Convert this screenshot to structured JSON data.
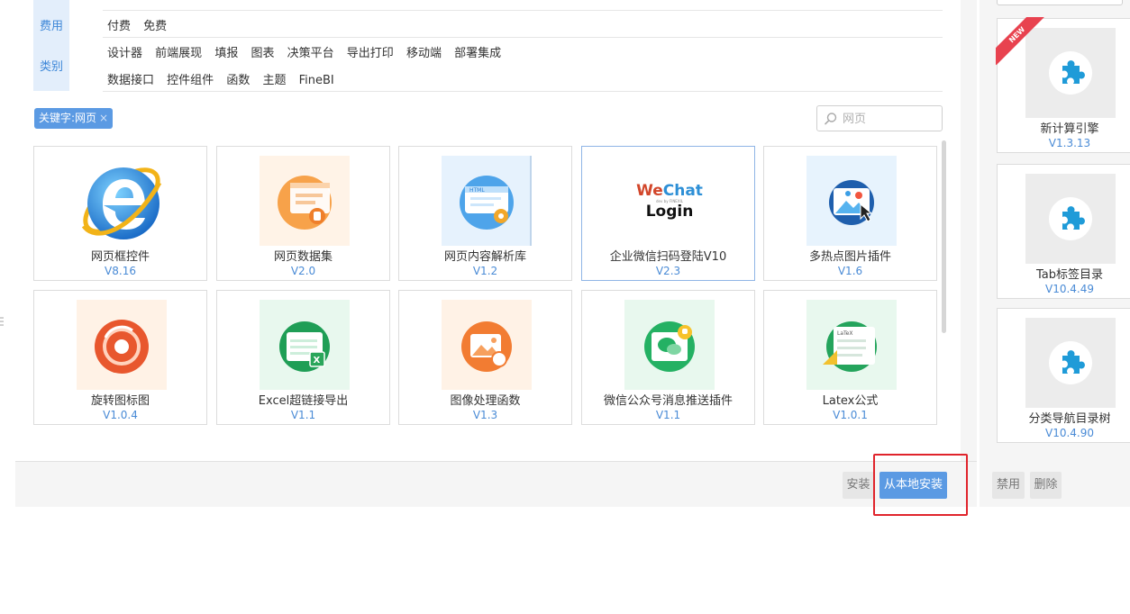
{
  "filters": {
    "row_top_partial": "",
    "fee": {
      "label": "费用",
      "options": [
        "付费",
        "免费"
      ]
    },
    "category": {
      "label": "类别",
      "options_line1": [
        "设计器",
        "前端展现",
        "填报",
        "图表",
        "决策平台",
        "导出打印",
        "移动端",
        "部署集成"
      ],
      "options_line2": [
        "数据接口",
        "控件组件",
        "函数",
        "主题",
        "FineBI"
      ]
    }
  },
  "keyword_tag": {
    "label": "关键字:网页",
    "close": "×"
  },
  "search": {
    "placeholder": "网页"
  },
  "plugins": [
    {
      "name": "网页框控件",
      "version": "V8.16",
      "icon": "ie-browser-icon"
    },
    {
      "name": "网页数据集",
      "version": "V2.0",
      "icon": "web-dataset-icon"
    },
    {
      "name": "网页内容解析库",
      "version": "V1.2",
      "icon": "html-parser-icon"
    },
    {
      "name": "企业微信扫码登陆V10",
      "version": "V2.3",
      "icon": "wechat-login-icon"
    },
    {
      "name": "多热点图片插件",
      "version": "V1.6",
      "icon": "hotspot-image-icon"
    },
    {
      "name": "旋转图标图",
      "version": "V1.0.4",
      "icon": "rotate-chart-icon"
    },
    {
      "name": "Excel超链接导出",
      "version": "V1.1",
      "icon": "excel-link-icon"
    },
    {
      "name": "图像处理函数",
      "version": "V1.3",
      "icon": "image-process-icon"
    },
    {
      "name": "微信公众号消息推送插件",
      "version": "V1.1",
      "icon": "wechat-push-icon"
    },
    {
      "name": "Latex公式",
      "version": "V1.0.1",
      "icon": "latex-icon"
    }
  ],
  "wechat_logo": {
    "we": "We",
    "chat": "Chat",
    "login": "Login",
    "sub": "dev by FINEXIL"
  },
  "actions": {
    "install": "安装",
    "install_local": "从本地安装"
  },
  "installed": [
    {
      "name": "新计算引擎",
      "version": "V1.3.13",
      "badge": "NEW"
    },
    {
      "name": "Tab标签目录",
      "version": "V10.4.49"
    },
    {
      "name": "分类导航目录树",
      "version": "V10.4.90"
    }
  ],
  "installed_actions": {
    "disable": "禁用",
    "delete": "删除"
  },
  "colors": {
    "accent": "#5b9ae3",
    "highlight": "#e0242c",
    "version": "#4a8bd6"
  }
}
